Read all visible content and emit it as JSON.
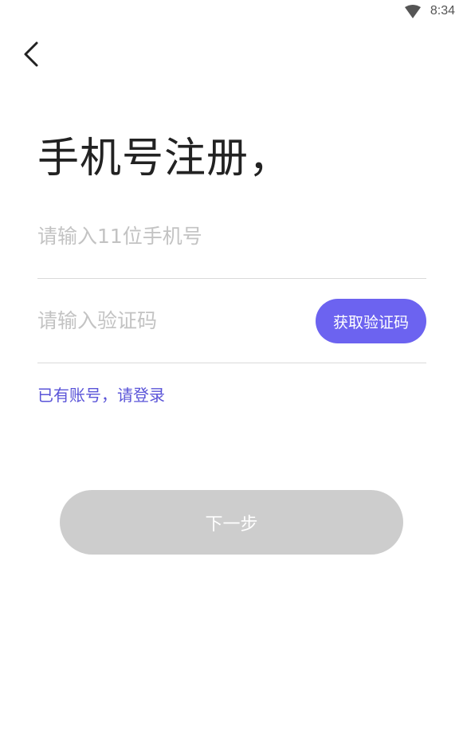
{
  "status_bar": {
    "time": "8:34",
    "wifi_icon": "wifi-icon"
  },
  "nav": {
    "back_icon": "chevron-left-icon"
  },
  "title": "手机号注册，",
  "phone_field": {
    "placeholder": "请输入11位手机号",
    "value": ""
  },
  "code_field": {
    "placeholder": "请输入验证码",
    "value": ""
  },
  "get_code_label": "获取验证码",
  "login_link": "已有账号，请登录",
  "next_label": "下一步",
  "colors": {
    "accent": "#6c63f0",
    "disabled": "#cdcdcd",
    "link": "#5a54d8"
  }
}
